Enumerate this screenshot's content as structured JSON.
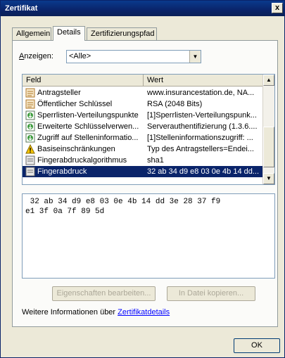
{
  "window": {
    "title": "Zertifikat",
    "close_glyph": "x"
  },
  "tabs": [
    {
      "label": "Allgemein"
    },
    {
      "label": "Details"
    },
    {
      "label": "Zertifizierungspfad"
    }
  ],
  "show": {
    "label_prefix": "A",
    "label_rest": "nzeigen:",
    "value": "<Alle>",
    "arrow": "▼"
  },
  "list": {
    "col_field": "Feld",
    "col_value": "Wert",
    "rows": [
      {
        "icon": "certificate-field-icon",
        "field": "Antragsteller",
        "value": "www.insurancestation.de, NA..."
      },
      {
        "icon": "certificate-field-icon",
        "field": "Öffentlicher Schlüssel",
        "value": "RSA (2048 Bits)"
      },
      {
        "icon": "extension-icon",
        "field": "Sperrlisten-Verteilungspunkte",
        "value": "[1]Sperrlisten-Verteilungspunk..."
      },
      {
        "icon": "extension-icon",
        "field": "Erweiterte Schlüsselverwen...",
        "value": "Serverauthentifizierung (1.3.6...."
      },
      {
        "icon": "extension-icon",
        "field": "Zugriff auf Stelleninformatio...",
        "value": "[1]Stelleninformationszugriff: ..."
      },
      {
        "icon": "warning-icon",
        "field": "Basiseinschränkungen",
        "value": "Typ des Antragstellers=Endei..."
      },
      {
        "icon": "property-icon",
        "field": "Fingerabdruckalgorithmus",
        "value": "sha1"
      },
      {
        "icon": "property-icon",
        "field": "Fingerabdruck",
        "value": "32 ab 34 d9 e8 03 0e 4b 14 dd...",
        "selected": true
      }
    ]
  },
  "detail": {
    "text": " 32 ab 34 d9 e8 03 0e 4b 14 dd 3e 28 37 f9\ne1 3f 0a 7f 89 5d"
  },
  "buttons": {
    "edit_properties": "Eigenschaften bearbeiten...",
    "copy_to_file": "In Datei kopieren...",
    "ok": "OK"
  },
  "info": {
    "text": "Weitere Informationen über ",
    "link": "Zertifikatdetails"
  }
}
